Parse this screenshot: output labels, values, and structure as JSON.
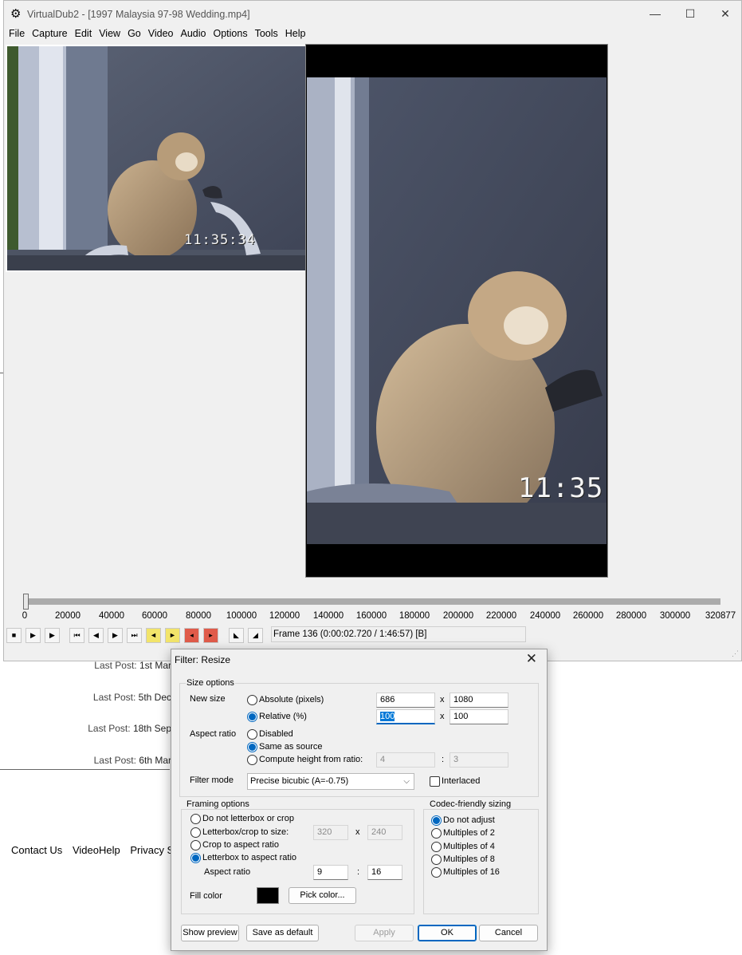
{
  "background": {
    "posts": [
      {
        "label": "Last Post:",
        "date": "1st Mar"
      },
      {
        "label": "Last Post:",
        "date": "5th Dec"
      },
      {
        "label": "Last Post:",
        "date": "18th Sep"
      },
      {
        "label": "Last Post:",
        "date": "6th Mar"
      }
    ],
    "footer_links": [
      "Contact Us",
      "VideoHelp",
      "Privacy Sta"
    ]
  },
  "window": {
    "title": "VirtualDub2  - [1997 Malaysia 97-98 Wedding.mp4]",
    "controls": {
      "minimize": "—",
      "maximize": "☐",
      "close": "✕"
    },
    "menu": [
      "File",
      "Capture",
      "Edit",
      "View",
      "Go",
      "Video",
      "Audio",
      "Options",
      "Tools",
      "Help"
    ],
    "input_timecode": "11:35:34",
    "output_timecode": "11:35",
    "timeline_ticks": [
      "0",
      "20000",
      "40000",
      "60000",
      "80000",
      "100000",
      "120000",
      "140000",
      "160000",
      "180000",
      "200000",
      "220000",
      "240000",
      "260000",
      "280000",
      "300000",
      "320877"
    ],
    "slider_position": 0.0004,
    "frame_status": "Frame 136 (0:00:02.720 / 1:46:57) [B]"
  },
  "dialog": {
    "title": "Filter: Resize",
    "close": "✕",
    "size_options": {
      "group_label": "Size options",
      "new_size_label": "New size",
      "absolute_label": "Absolute (pixels)",
      "absolute_w": "686",
      "absolute_h": "1080",
      "relative_label": "Relative (%)",
      "relative_w": "100",
      "relative_h": "100",
      "x": "x",
      "aspect_label": "Aspect ratio",
      "disabled_label": "Disabled",
      "same_label": "Same as source",
      "compute_label": "Compute height from ratio:",
      "ratio_a": "4",
      "ratio_b": "3",
      "colon": ":",
      "filter_mode_label": "Filter mode",
      "filter_mode_value": "Precise bicubic (A=-0.75)",
      "interlaced_label": "Interlaced"
    },
    "framing": {
      "group_label": "Framing options",
      "opt_none": "Do not letterbox or crop",
      "opt_letterbox_size": "Letterbox/crop to size:",
      "size_w": "320",
      "size_h": "240",
      "x": "x",
      "opt_crop_aspect": "Crop to aspect ratio",
      "opt_letterbox_aspect": "Letterbox to aspect ratio",
      "aspect_label": "Aspect ratio",
      "aspect_a": "9",
      "aspect_b": "16",
      "colon": ":",
      "fill_label": "Fill color",
      "fill_color": "#000000",
      "pick_color": "Pick color..."
    },
    "codec": {
      "group_label": "Codec-friendly sizing",
      "options": [
        "Do not adjust",
        "Multiples of 2",
        "Multiples of 4",
        "Multiples of 8",
        "Multiples of 16"
      ]
    },
    "buttons": {
      "show_preview": "Show preview",
      "save_default": "Save as default",
      "apply": "Apply",
      "ok": "OK",
      "cancel": "Cancel"
    }
  }
}
